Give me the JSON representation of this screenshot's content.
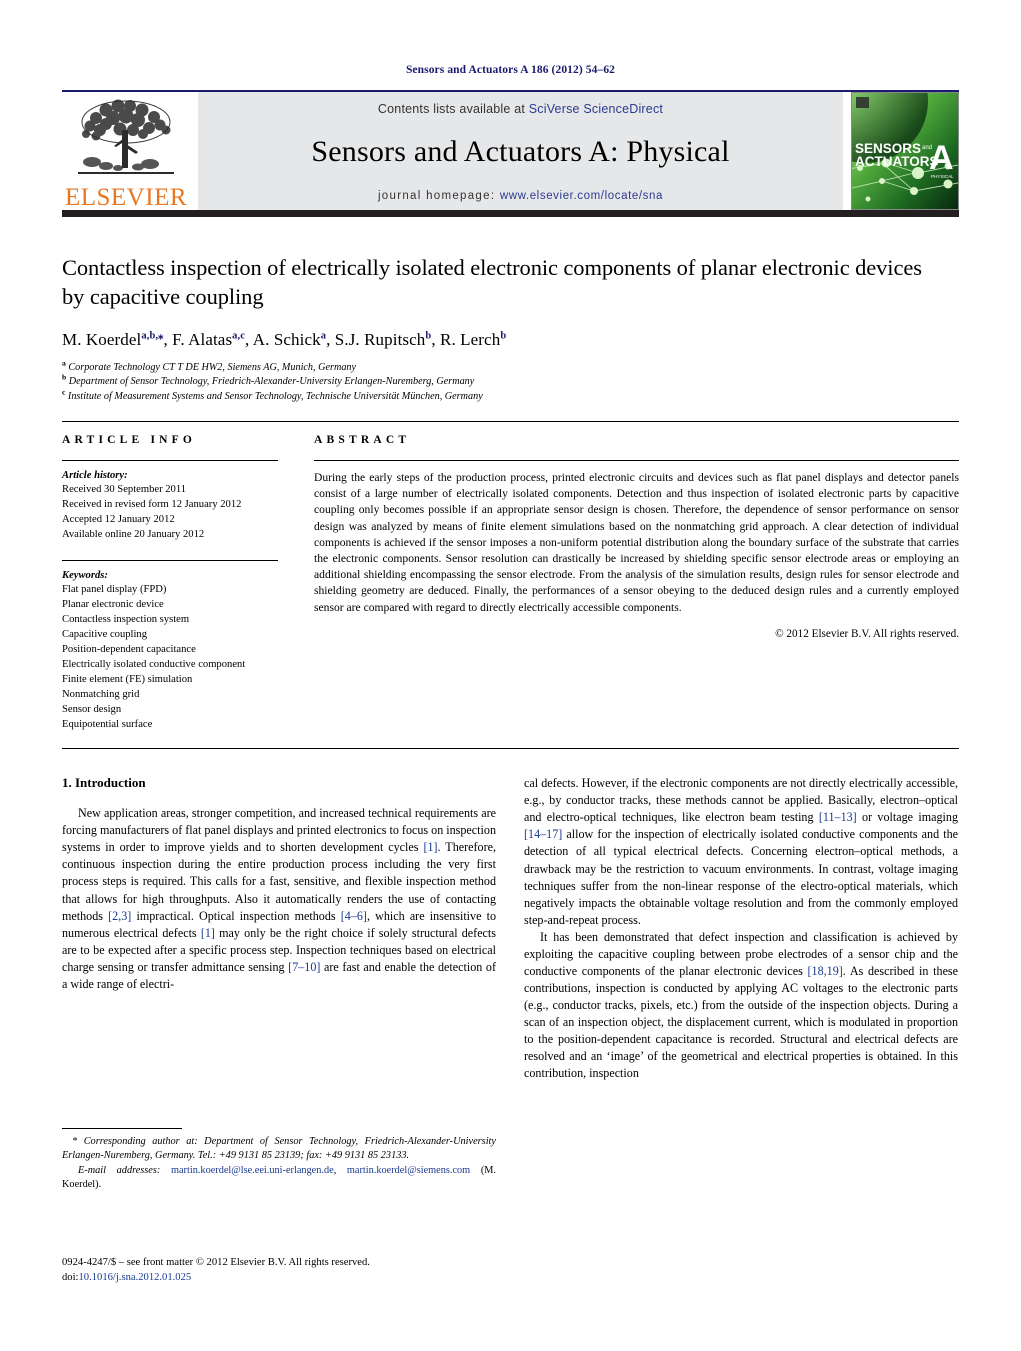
{
  "running_head": "Sensors and Actuators A 186 (2012) 54–62",
  "masthead": {
    "publisher_name": "ELSEVIER",
    "contents_prefix": "Contents lists available at ",
    "contents_link": "SciVerse ScienceDirect",
    "journal_title": "Sensors and Actuators A: Physical",
    "homepage_prefix": "journal homepage: ",
    "homepage_url": "www.elsevier.com/locate/sna",
    "cover": {
      "line1": "SENSORS",
      "line1_small": "and",
      "line2": "ACTUATORS",
      "letter": "A",
      "sublabel": "PHYSICAL"
    }
  },
  "colors": {
    "elsevier_orange": "#E87722",
    "link_blue": "#2b3b8f",
    "ref_blue": "#1a3a8f",
    "runhead_navy": "#1a1a6e",
    "band_gray": "#e6e7e9",
    "rule_black": "#231f20",
    "cover_green": "#3fa535"
  },
  "title": "Contactless inspection of electrically isolated electronic components of planar electronic devices by capacitive coupling",
  "authors": [
    {
      "name": "M. Koerdel",
      "sup": "a,b,⁎"
    },
    {
      "name": "F. Alatas",
      "sup": "a,c"
    },
    {
      "name": "A. Schick",
      "sup": "a"
    },
    {
      "name": "S.J. Rupitsch",
      "sup": "b"
    },
    {
      "name": "R. Lerch",
      "sup": "b"
    }
  ],
  "affiliations": [
    {
      "marker": "a",
      "text": "Corporate Technology CT T DE HW2, Siemens AG, Munich, Germany"
    },
    {
      "marker": "b",
      "text": "Department of Sensor Technology, Friedrich-Alexander-University Erlangen-Nuremberg, Germany"
    },
    {
      "marker": "c",
      "text": "Institute of Measurement Systems and Sensor Technology, Technische Universität München, Germany"
    }
  ],
  "article_info": {
    "heading": "ARTICLE INFO",
    "history_label": "Article history:",
    "history": [
      "Received 30 September 2011",
      "Received in revised form 12 January 2012",
      "Accepted 12 January 2012",
      "Available online 20 January 2012"
    ],
    "keywords_label": "Keywords:",
    "keywords": [
      "Flat panel display (FPD)",
      "Planar electronic device",
      "Contactless inspection system",
      "Capacitive coupling",
      "Position-dependent capacitance",
      "Electrically isolated conductive component",
      "Finite element (FE) simulation",
      "Nonmatching grid",
      "Sensor design",
      "Equipotential surface"
    ]
  },
  "abstract": {
    "heading": "ABSTRACT",
    "text": "During the early steps of the production process, printed electronic circuits and devices such as flat panel displays and detector panels consist of a large number of electrically isolated components. Detection and thus inspection of isolated electronic parts by capacitive coupling only becomes possible if an appropriate sensor design is chosen. Therefore, the dependence of sensor performance on sensor design was analyzed by means of finite element simulations based on the nonmatching grid approach. A clear detection of individual components is achieved if the sensor imposes a non-uniform potential distribution along the boundary surface of the substrate that carries the electronic components. Sensor resolution can drastically be increased by shielding specific sensor electrode areas or employing an additional shielding encompassing the sensor electrode. From the analysis of the simulation results, design rules for sensor electrode and shielding geometry are deduced. Finally, the performances of a sensor obeying to the deduced design rules and a currently employed sensor are compared with regard to directly electrically accessible components.",
    "copyright": "© 2012 Elsevier B.V. All rights reserved."
  },
  "introduction": {
    "heading": "1.  Introduction",
    "left_p1_a": "New application areas, stronger competition, and increased technical requirements are forcing manufacturers of flat panel displays and printed electronics to focus on inspection systems in order to improve yields and to shorten development cycles ",
    "ref1": "[1]",
    "left_p1_b": ". Therefore, continuous inspection during the entire production process including the very first process steps is required. This calls for a fast, sensitive, and flexible inspection method that allows for high throughputs. Also it automatically renders the use of contacting methods ",
    "ref2": "[2,3]",
    "left_p1_c": " impractical. Optical inspection methods ",
    "ref3": "[4–6]",
    "left_p1_d": ", which are insensitive to numerous electrical defects ",
    "ref4": "[1]",
    "left_p1_e": " may only be the right choice if solely structural defects are to be expected after a specific process step. Inspection techniques based on electrical charge sensing or transfer admittance sensing ",
    "ref5": "[7–10]",
    "left_p1_f": " are fast and enable the detection of a wide range of electri-",
    "right_p1_a": "cal defects. However, if the electronic components are not directly electrically accessible, e.g., by conductor tracks, these methods cannot be applied. Basically, electron–optical and electro-optical techniques, like electron beam testing ",
    "ref6": "[11–13]",
    "right_p1_b": " or voltage imaging ",
    "ref7": "[14–17]",
    "right_p1_c": " allow for the inspection of electrically isolated conductive components and the detection of all typical electrical defects. Concerning electron–optical methods, a drawback may be the restriction to vacuum environments. In contrast, voltage imaging techniques suffer from the non-linear response of the electro-optical materials, which negatively impacts the obtainable voltage resolution and from the commonly employed step-and-repeat process.",
    "right_p2_a": "It has been demonstrated that defect inspection and classification is achieved by exploiting the capacitive coupling between probe electrodes of a sensor chip and the conductive components of the planar electronic devices ",
    "ref8": "[18,19]",
    "right_p2_b": ". As described in these contributions, inspection is conducted by applying AC voltages to the electronic parts (e.g., conductor tracks, pixels, etc.) from the outside of the inspection objects. During a scan of an inspection object, the displacement current, which is modulated in proportion to the position-dependent capacitance is recorded. Structural and electrical defects are resolved and an ‘image’ of the geometrical and electrical properties is obtained. In this contribution, inspection"
  },
  "footnote": {
    "corresponding": "* Corresponding author at: Department of Sensor Technology, Friedrich-Alexander-University Erlangen-Nuremberg, Germany. Tel.: +49 9131 85 23139; fax: +49 9131 85 23133.",
    "email_label": "E-mail addresses:",
    "email1": "martin.koerdel@lse.eei.uni-erlangen.de",
    "email2": "martin.koerdel@siemens.com",
    "email_suffix": "(M. Koerdel)."
  },
  "issn": {
    "front_matter": "0924-4247/$ – see front matter © 2012 Elsevier B.V. All rights reserved.",
    "doi_label": "doi:",
    "doi_value": "10.1016/j.sna.2012.01.025"
  }
}
